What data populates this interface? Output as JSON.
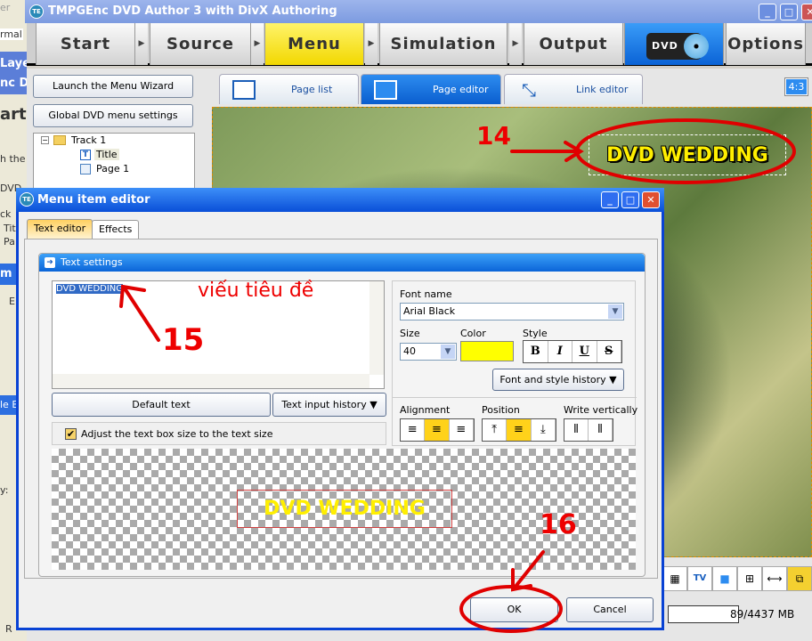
{
  "background_window": {
    "fragments": [
      "er",
      "rmal",
      "Laye",
      "nc D",
      "art",
      "h the",
      "DVD",
      "ck",
      "Tit",
      "Pa",
      "m",
      "E",
      "le B",
      "y:",
      "R"
    ]
  },
  "window": {
    "title": "TMPGEnc DVD Author 3 with DivX Authoring",
    "icon": "TE",
    "minimize": "_",
    "maximize": "□",
    "close": "✕"
  },
  "nav": {
    "steps": [
      "Start",
      "Source",
      "Menu",
      "Simulation",
      "Output"
    ],
    "dvd_label": "DVD",
    "options": "Options",
    "active": "Menu",
    "active_color": "#f7e000"
  },
  "left_panel": {
    "wizard_button": "Launch the Menu Wizard",
    "global_button": "Global DVD menu settings",
    "tree": {
      "track": "Track 1",
      "children": [
        "Title",
        "Page 1"
      ],
      "selected": "Title"
    }
  },
  "editor_tabs": [
    {
      "label": "Page list"
    },
    {
      "label": "Page editor",
      "active": true
    },
    {
      "label": "Link editor"
    }
  ],
  "aspect_badge": "4:3",
  "preview": {
    "title_text": "DVD WEDDING",
    "title_color": "#ffef00"
  },
  "toolbar_icons": [
    "grid-layout-icon",
    "tv-safe-area-icon",
    "select-area-icon",
    "grid-icon",
    "horizontal-arrows-icon",
    "overlay-icon"
  ],
  "status": {
    "usage": "89/4437  MB",
    "input_value": ""
  },
  "dialog": {
    "title": "Menu item editor",
    "tabs": [
      "Text editor",
      "Effects"
    ],
    "active_tab": "Text editor",
    "group_title": "Text settings",
    "text_value": "DVD WEDDING",
    "default_text_button": "Default text",
    "history_button": "Text input history",
    "adjust_checkbox": {
      "label": "Adjust the text box size to the text size",
      "checked": true
    },
    "font_name_label": "Font name",
    "font_name": "Arial Black",
    "size_label": "Size",
    "size": "40",
    "color_label": "Color",
    "color": "#ffff00",
    "style_label": "Style",
    "style_buttons": [
      "B",
      "I",
      "U",
      "S"
    ],
    "font_history_button": "Font and style history",
    "alignment_label": "Alignment",
    "alignment": "center",
    "position_label": "Position",
    "position": "middle",
    "vertical_label": "Write vertically",
    "preview_text": "DVD WEDDING",
    "ok": "OK",
    "cancel": "Cancel"
  },
  "annotations": {
    "step14": "14",
    "step15": "15",
    "step16": "16",
    "note": "viếu tiêu đề",
    "color": "#e00000"
  }
}
